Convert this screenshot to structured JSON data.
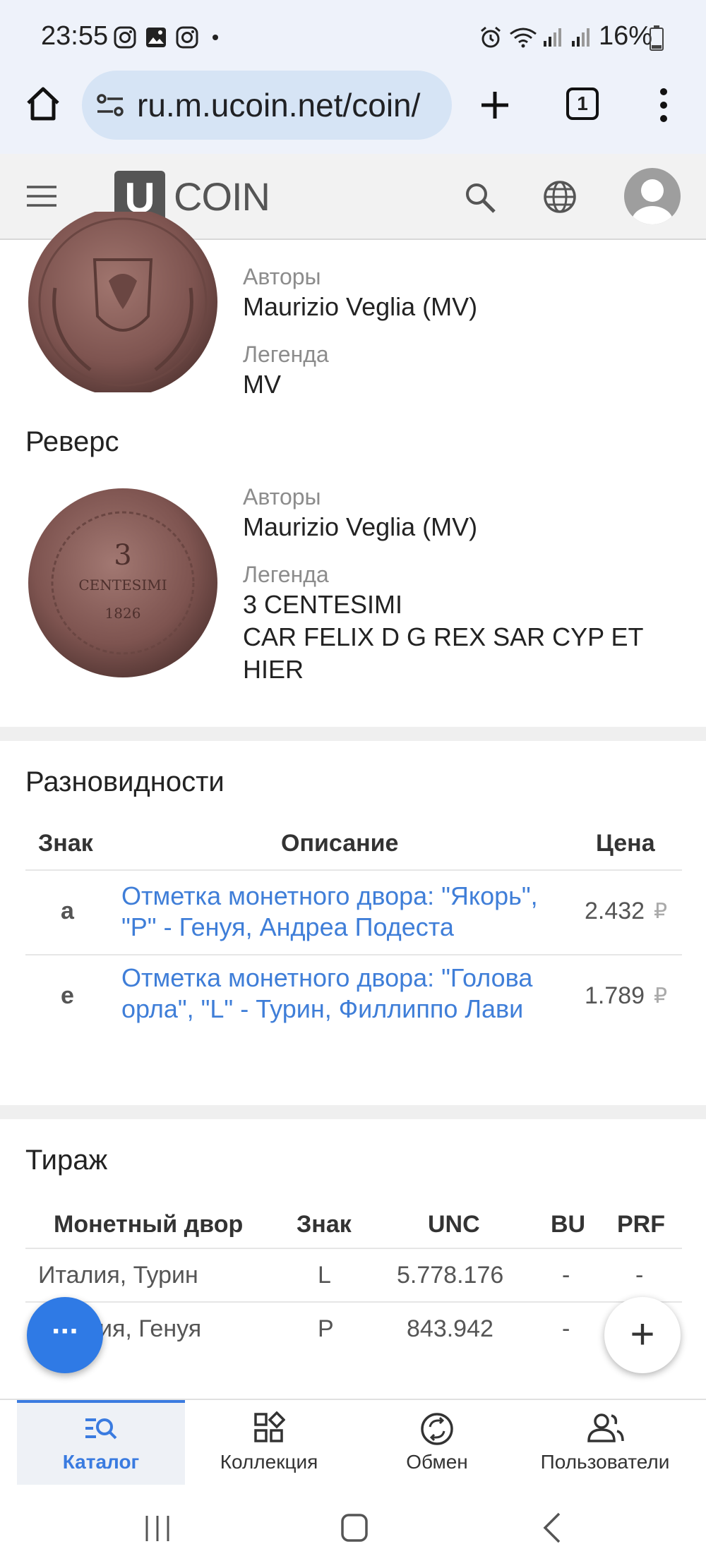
{
  "status_bar": {
    "time": "23:55",
    "battery": "16%",
    "left_icons": [
      "instagram-icon",
      "gallery-icon",
      "instagram-icon",
      "dot-icon"
    ],
    "right_icons": [
      "alarm-icon",
      "wifi-icon",
      "signal-icon",
      "signal-icon",
      "battery-icon"
    ]
  },
  "browser": {
    "url": "ru.m.ucoin.net/coin/",
    "tab_count": "1"
  },
  "header": {
    "logo_letter": "U",
    "logo_text": "COIN"
  },
  "obverse": {
    "authors_label": "Авторы",
    "authors_value": "Maurizio Veglia (MV)",
    "legend_label": "Легенда",
    "legend_value": "MV"
  },
  "reverse": {
    "title": "Реверс",
    "authors_label": "Авторы",
    "authors_value": "Maurizio Veglia (MV)",
    "legend_label": "Легенда",
    "legend_line1": "3 CENTESIMI",
    "legend_line2": "CAR FELIX D G REX SAR CYP ET",
    "legend_line3": "HIER",
    "coin_text_top": "3",
    "coin_text_mid": "CENTESIMI",
    "coin_text_year": "1826"
  },
  "varieties": {
    "title": "Разновидности",
    "headers": [
      "Знак",
      "Описание",
      "Цена"
    ],
    "rows": [
      {
        "mark": "a",
        "desc1": "Отметка монетного двора: \"Якорь\",",
        "desc2": "\"P\" - Генуя, Андреа Подеста",
        "price": "2.432",
        "currency": "₽"
      },
      {
        "mark": "e",
        "desc1": "Отметка монетного двора: \"Голова",
        "desc2": "орла\", \"L\" - Турин, Филлиппо Лави",
        "price": "1.789",
        "currency": "₽"
      }
    ]
  },
  "mintage": {
    "title": "Тираж",
    "headers": [
      "Монетный двор",
      "Знак",
      "UNC",
      "BU",
      "PRF"
    ],
    "rows": [
      {
        "mint": "Италия, Турин",
        "mark": "L",
        "unc": "5.778.176",
        "bu": "-",
        "prf": "-"
      },
      {
        "mint": "ия, Генуя",
        "mark": "P",
        "unc": "843.942",
        "bu": "-",
        "prf": ""
      }
    ]
  },
  "fab": {
    "more_symbol": "···",
    "add_symbol": "+"
  },
  "bottom_nav": [
    {
      "label": "Каталог",
      "icon": "catalog-search-icon",
      "active": true
    },
    {
      "label": "Коллекция",
      "icon": "collection-icon",
      "active": false
    },
    {
      "label": "Обмен",
      "icon": "exchange-icon",
      "active": false
    },
    {
      "label": "Пользователи",
      "icon": "users-icon",
      "active": false
    }
  ],
  "colors": {
    "link": "#3f7ed8",
    "accent": "#2f7ae5",
    "active_nav": "#3a7be0"
  }
}
